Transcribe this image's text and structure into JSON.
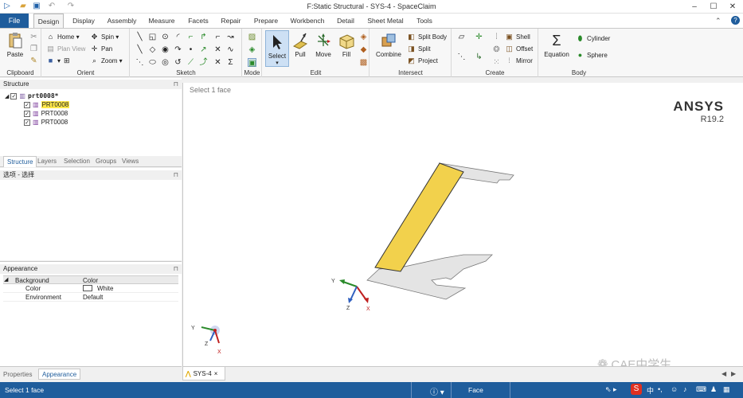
{
  "window": {
    "title": "F:Static Structural - SYS-4 - SpaceClaim"
  },
  "tabs": [
    {
      "label": "File"
    },
    {
      "label": "Design"
    },
    {
      "label": "Display"
    },
    {
      "label": "Assembly"
    },
    {
      "label": "Measure"
    },
    {
      "label": "Facets"
    },
    {
      "label": "Repair"
    },
    {
      "label": "Prepare"
    },
    {
      "label": "Workbench"
    },
    {
      "label": "Detail"
    },
    {
      "label": "Sheet Metal"
    },
    {
      "label": "Tools"
    }
  ],
  "ribbon": {
    "clipboard": {
      "label": "Clipboard",
      "paste": "Paste"
    },
    "orient": {
      "label": "Orient",
      "home": "Home",
      "plan_view": "Plan View",
      "spin": "Spin",
      "pan": "Pan",
      "zoom": "Zoom"
    },
    "sketch": {
      "label": "Sketch"
    },
    "mode": {
      "label": "Mode"
    },
    "edit": {
      "label": "Edit",
      "select": "Select",
      "pull": "Pull",
      "move": "Move",
      "fill": "Fill"
    },
    "intersect": {
      "label": "Intersect",
      "combine": "Combine",
      "split_body": "Split Body",
      "split": "Split",
      "project": "Project"
    },
    "create": {
      "label": "Create",
      "shell": "Shell",
      "offset": "Offset",
      "mirror": "Mirror"
    },
    "body": {
      "label": "Body",
      "equation": "Equation",
      "cylinder": "Cylinder",
      "sphere": "Sphere"
    }
  },
  "structure": {
    "title": "Structure",
    "root": "prt0008*",
    "children": [
      "PRT0008",
      "PRT0008",
      "PRT0008"
    ],
    "subtabs": [
      "Structure",
      "Layers",
      "Selection",
      "Groups",
      "Views"
    ]
  },
  "options": {
    "title": "选项 - 选择"
  },
  "appearance": {
    "title": "Appearance",
    "header": {
      "name": "Background",
      "value": "Color"
    },
    "rows": [
      {
        "name": "Color",
        "value": "White"
      },
      {
        "name": "Environment",
        "value": "Default"
      }
    ],
    "bottom_tabs": [
      "Properties",
      "Appearance"
    ]
  },
  "viewport": {
    "hint": "Select 1 face",
    "logo": "ANSYS",
    "version": "R19.2",
    "doc_tab": "SYS-4",
    "axes": {
      "x": "X",
      "y": "Y",
      "z": "Z"
    },
    "watermark": "CAE中学生",
    "colors": {
      "selected_face": "#f2d14c",
      "body": "#e4e4e4",
      "edge": "#777777"
    }
  },
  "status": {
    "message": "Select 1 face",
    "mode": "Face",
    "ime": "中"
  }
}
